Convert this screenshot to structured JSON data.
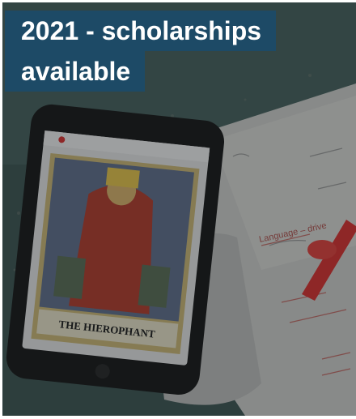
{
  "card": {
    "title_line1": "2021 - scholarships",
    "title_line2": "available"
  },
  "photo": {
    "phone_card_caption": "THE HIEROPHANT",
    "notebook_note": "Language – drive"
  },
  "colors": {
    "title_bg": "#1d4a66",
    "title_text": "#ffffff",
    "pen": "#d8302e"
  }
}
